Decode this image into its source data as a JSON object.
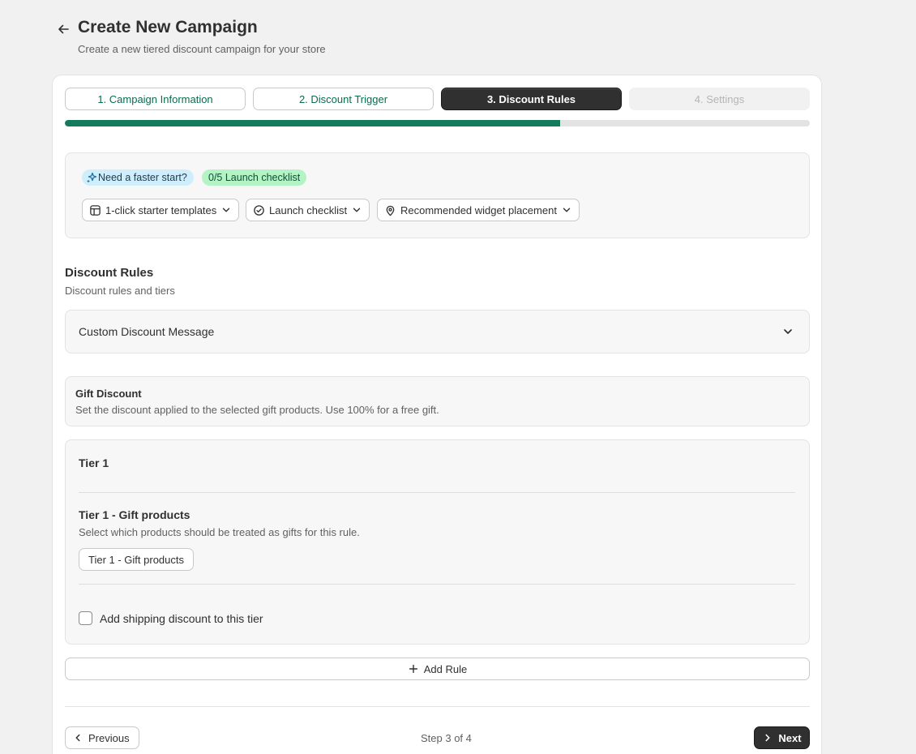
{
  "header": {
    "title": "Create New Campaign",
    "subtitle": "Create a new tiered discount campaign for your store",
    "back_icon": "arrow-left-icon"
  },
  "steps": [
    {
      "label": "1. Campaign Information",
      "state": "complete"
    },
    {
      "label": "2. Discount Trigger",
      "state": "complete"
    },
    {
      "label": "3. Discount Rules",
      "state": "active"
    },
    {
      "label": "4. Settings",
      "state": "disabled"
    }
  ],
  "progress": {
    "percent": 66.5,
    "color": "#137a5c"
  },
  "quick_start": {
    "info_badge": "Need a faster start?",
    "checklist_badge": "0/5 Launch checklist",
    "buttons": [
      {
        "label": "1-click starter templates",
        "icon": "template-icon"
      },
      {
        "label": "Launch checklist",
        "icon": "check-circle-icon"
      },
      {
        "label": "Recommended widget placement",
        "icon": "location-pin-icon"
      }
    ]
  },
  "discount_rules": {
    "title": "Discount Rules",
    "subtitle": "Discount rules and tiers",
    "custom_message_label": "Custom Discount Message"
  },
  "gift_discount": {
    "title": "Gift Discount",
    "description": "Set the discount applied to the selected gift products. Use 100% for a free gift."
  },
  "tier": {
    "title": "Tier 1",
    "gift_title": "Tier 1 - Gift products",
    "gift_description": "Select which products should be treated as gifts for this rule.",
    "gift_button": "Tier 1 - Gift products",
    "shipping_checkbox_label": "Add shipping discount to this tier",
    "shipping_checked": false
  },
  "add_rule_label": "Add Rule",
  "footer": {
    "previous_label": "Previous",
    "step_counter": "Step 3 of 4",
    "next_label": "Next"
  },
  "colors": {
    "accent": "#137a5c",
    "primary_button": "#303030",
    "info_badge_bg": "#cfeefc",
    "success_badge_bg": "#b3f3c4"
  }
}
